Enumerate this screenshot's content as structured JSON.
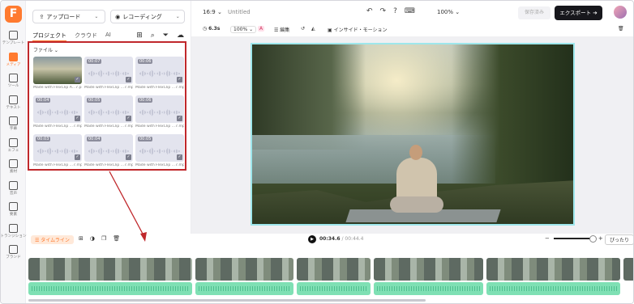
{
  "rail": {
    "items": [
      {
        "label": "テンプレート",
        "icon": "template-icon"
      },
      {
        "label": "メディア",
        "icon": "media-icon"
      },
      {
        "label": "ツール",
        "icon": "tools-icon"
      },
      {
        "label": "テキスト",
        "icon": "text-icon"
      },
      {
        "label": "字幕",
        "icon": "subtitle-icon"
      },
      {
        "label": "エフェ",
        "icon": "effects-icon"
      },
      {
        "label": "素材",
        "icon": "elements-icon"
      },
      {
        "label": "音声",
        "icon": "audio-icon"
      },
      {
        "label": "要素",
        "icon": "shapes-icon"
      },
      {
        "label": "トランジション",
        "icon": "transition-icon"
      },
      {
        "label": "ブランド",
        "icon": "brand-icon"
      }
    ]
  },
  "panel": {
    "upload_label": "アップロード",
    "record_label": "レコーディング",
    "tabs": [
      "プロジェクト",
      "クラウド",
      "AI"
    ],
    "filter_label": "ファイル",
    "files": [
      {
        "type": "image",
        "duration": "",
        "name": "Made with FlexClip A...7.png"
      },
      {
        "type": "audio",
        "duration": "00:07",
        "name": "Made with FlexClip ...7.mp3"
      },
      {
        "type": "audio",
        "duration": "00:06",
        "name": "Made with FlexClip ...7.mp3"
      },
      {
        "type": "audio",
        "duration": "00:04",
        "name": "Made with FlexClip ...7.mp3"
      },
      {
        "type": "audio",
        "duration": "00:05",
        "name": "Made with FlexClip ...7.mp3"
      },
      {
        "type": "audio",
        "duration": "00:06",
        "name": "Made with FlexClip ...7.mp3"
      },
      {
        "type": "audio",
        "duration": "00:03",
        "name": "Made with FlexClip ...7.mp3"
      },
      {
        "type": "audio",
        "duration": "00:04",
        "name": "Made with FlexClip ...7.mp3"
      },
      {
        "type": "audio",
        "duration": "00:05",
        "name": "Made with FlexClip ...7.mp3"
      }
    ]
  },
  "topbar": {
    "ratio": "16:9",
    "title": "Untitled",
    "zoom": "100%",
    "saved_label": "保存済み",
    "export_label": "エクスポート"
  },
  "edit_toolbar": {
    "duration": "6.3s",
    "scale": "100%",
    "edit_label": "編集",
    "motion_label": "インサイド・モーション"
  },
  "timeline": {
    "label": "タイムライン",
    "current_time": "00:34.6",
    "total_time": "/ 00:44.4",
    "fit_label": "ぴったり"
  },
  "colors": {
    "accent": "#ff7a2f",
    "selection": "#c0282c",
    "audio_track": "#7fe0b4",
    "export_button": "#17171c"
  }
}
